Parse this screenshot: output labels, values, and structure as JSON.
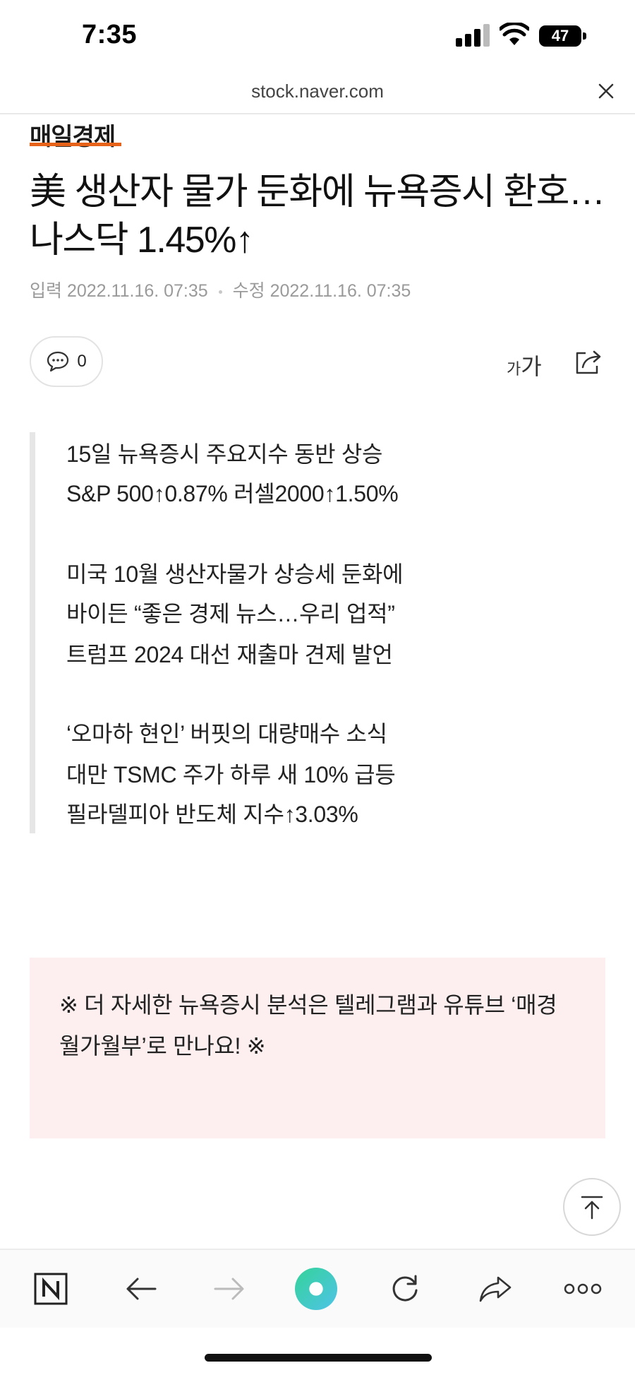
{
  "status_bar": {
    "time": "7:35",
    "battery": "47"
  },
  "browser": {
    "url": "stock.naver.com"
  },
  "article": {
    "press": "매일경제",
    "headline": "美 생산자 물가 둔화에 뉴욕증시 환호… 나스닥 1.45%↑",
    "input_label": "입력",
    "input_date": "2022.11.16. 07:35",
    "edit_label": "수정",
    "edit_date": "2022.11.16. 07:35",
    "comment_count": "0",
    "font_size_small": "가",
    "font_size_large": "가",
    "summary": [
      "15일 뉴욕증시 주요지수 동반 상승",
      "S&P 500↑0.87% 러셀2000↑1.50%",
      "미국 10월 생산자물가 상승세 둔화에",
      "바이든 “좋은 경제 뉴스…우리 업적”",
      "트럼프 2024 대선 재출마 견제 발언",
      "‘오마하 현인’ 버핏의 대량매수 소식",
      "대만 TSMC 주가 하루 새 10% 급등",
      "필라델피아 반도체 지수↑3.03%"
    ],
    "notice": "※ 더 자세한 뉴욕증시 분석은 텔레그램과 유튜브 ‘매경 월가월부’로 만나요! ※"
  },
  "colors": {
    "accent_logo_bar": "#e8631a",
    "notice_bg": "#fdefef",
    "naver_green": "#2ecc71"
  },
  "nav": {
    "items": [
      "naver-home-icon",
      "back-icon",
      "forward-icon",
      "green-dot-icon",
      "reload-icon",
      "share-icon",
      "more-icon"
    ]
  }
}
